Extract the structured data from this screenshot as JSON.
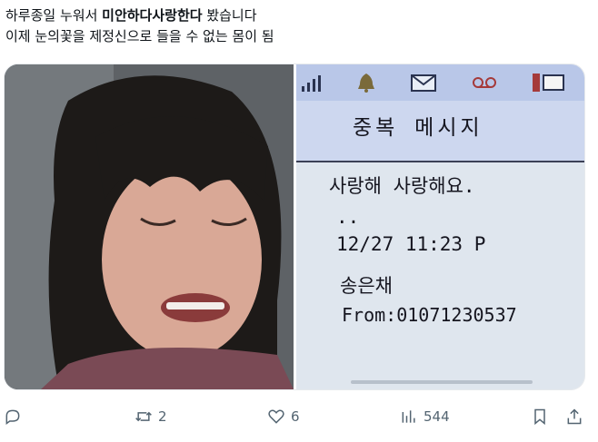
{
  "tweet": {
    "line1_prefix": "하루종일 누워서 ",
    "line1_bold": "미안하다사랑한다",
    "line1_suffix": " 봤습니다",
    "line2": "이제 눈의꽃을 제정신으로 들을 수 없는 몸이 됨"
  },
  "phone_screen": {
    "header_title": "중복 메시지",
    "message_line": "사랑해 사랑해요.",
    "dots": "..",
    "timestamp": "12/27 11:23 P",
    "sender_name": "송은채",
    "from_number": "From:01071230537"
  },
  "actions": {
    "reply_count": "",
    "retweet_count": "2",
    "like_count": "6",
    "views_count": "544"
  },
  "colors": {
    "text_primary": "#0f1419",
    "text_secondary": "#536471",
    "phone_status_bar": "#b9c7e8",
    "phone_screen": "#dfe6ee"
  },
  "icons": [
    "reply-icon",
    "retweet-icon",
    "like-icon",
    "views-icon",
    "bookmark-icon",
    "share-icon",
    "signal-icon",
    "bell-icon",
    "envelope-icon",
    "voicemail-icon",
    "battery-icon"
  ]
}
